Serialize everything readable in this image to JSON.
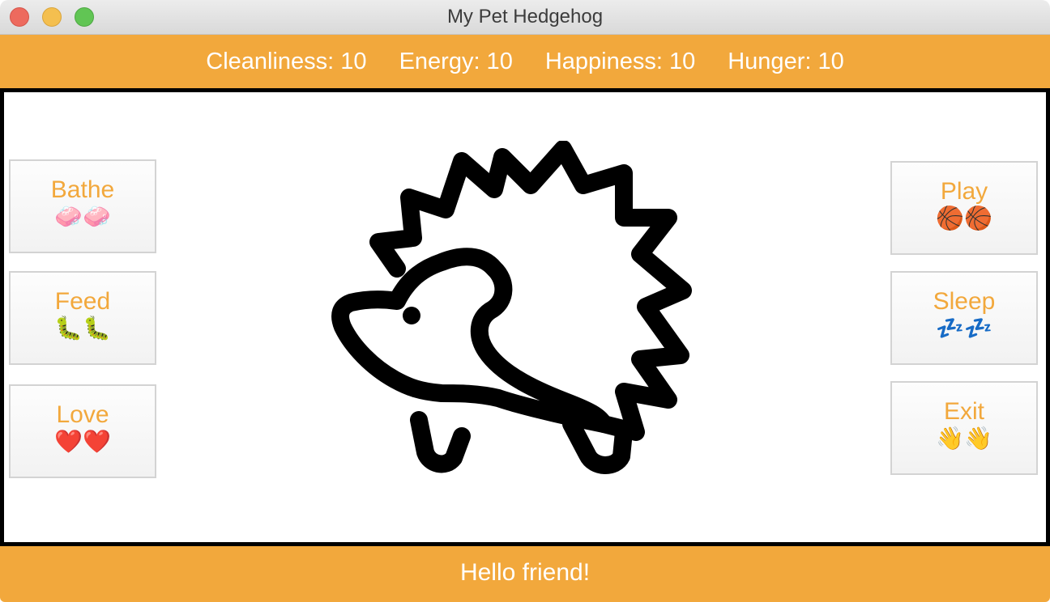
{
  "window": {
    "title": "My Pet Hedgehog"
  },
  "stats": [
    {
      "label": "Cleanliness: 10"
    },
    {
      "label": "Energy: 10"
    },
    {
      "label": "Happiness: 10"
    },
    {
      "label": "Hunger: 10"
    }
  ],
  "actions": {
    "left": [
      {
        "label": "Bathe",
        "emoji": "🧼🧼",
        "icon": "soap-icon"
      },
      {
        "label": "Feed",
        "emoji": "🐛🐛",
        "icon": "bug-icon"
      },
      {
        "label": "Love",
        "emoji": "❤️❤️",
        "icon": "heart-icon"
      }
    ],
    "right": [
      {
        "label": "Play",
        "emoji": "🏀🏀",
        "icon": "basketball-icon"
      },
      {
        "label": "Sleep",
        "emoji": "💤💤",
        "icon": "zzz-icon"
      },
      {
        "label": "Exit",
        "emoji": "👋👋",
        "icon": "waving-hand-icon"
      }
    ]
  },
  "pet": {
    "icon": "hedgehog-icon"
  },
  "footer": {
    "message": "Hello friend!"
  },
  "colors": {
    "accent": "#f2a83c",
    "border": "#000000"
  }
}
